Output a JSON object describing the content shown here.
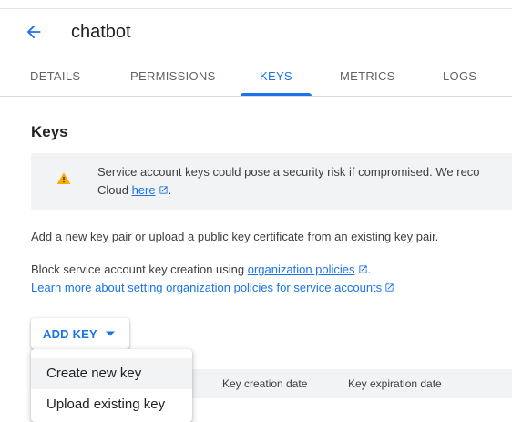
{
  "header": {
    "title": "chatbot",
    "back_icon": "arrow-back-icon"
  },
  "tabs": [
    {
      "label": "DETAILS",
      "active": false
    },
    {
      "label": "PERMISSIONS",
      "active": false
    },
    {
      "label": "KEYS",
      "active": true
    },
    {
      "label": "METRICS",
      "active": false
    },
    {
      "label": "LOGS",
      "active": false
    }
  ],
  "keys_section": {
    "title": "Keys",
    "warning": {
      "icon": "warning-icon",
      "text_line1": "Service account keys could pose a security risk if compromised. We reco",
      "text_line2_prefix": "Cloud ",
      "link_text": "here"
    },
    "intro": "Add a new key pair or upload a public key certificate from an existing key pair.",
    "block_text": "Block service account key creation using ",
    "block_link": "organization policies",
    "block_suffix": ".",
    "learn_more_link": "Learn more about setting organization policies for service accounts"
  },
  "add_key": {
    "label": "ADD KEY",
    "menu_items": [
      "Create new key",
      "Upload existing key"
    ]
  },
  "table": {
    "columns": [
      "Key creation date",
      "Key expiration date"
    ]
  },
  "colors": {
    "accent": "#1a73e8",
    "warning": "#f9ab00",
    "muted_bg": "#f1f3f4"
  }
}
